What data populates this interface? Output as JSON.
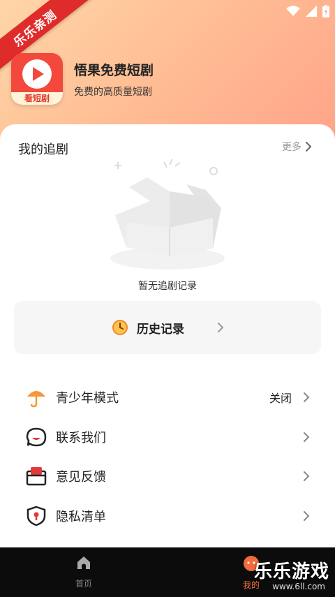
{
  "badge": {
    "text": "乐乐亲测"
  },
  "app": {
    "name": "悟果免费短剧",
    "subtitle": "免费的高质量短剧",
    "logo_tag": "看短剧"
  },
  "section": {
    "title": "我的追剧",
    "more_label": "更多"
  },
  "empty_state": {
    "text": "暂无追剧记录"
  },
  "history": {
    "label": "历史记录"
  },
  "menu": [
    {
      "label": "青少年模式",
      "value": "关闭",
      "icon": "umbrella-icon"
    },
    {
      "label": "联系我们",
      "icon": "chat-bubble-icon"
    },
    {
      "label": "意见反馈",
      "icon": "feedback-box-icon"
    },
    {
      "label": "隐私清单",
      "icon": "shield-icon"
    }
  ],
  "tabs": [
    {
      "label": "首页",
      "icon": "home-icon",
      "active": false
    },
    {
      "label": "我的",
      "icon": "profile-icon",
      "active": true
    }
  ],
  "watermark": {
    "brand": "乐乐游戏",
    "url": "www.6ll.com"
  },
  "colors": {
    "accent": "#f36b3c",
    "logo_red": "#f5483c",
    "ribbon_red": "#e02b2b"
  }
}
